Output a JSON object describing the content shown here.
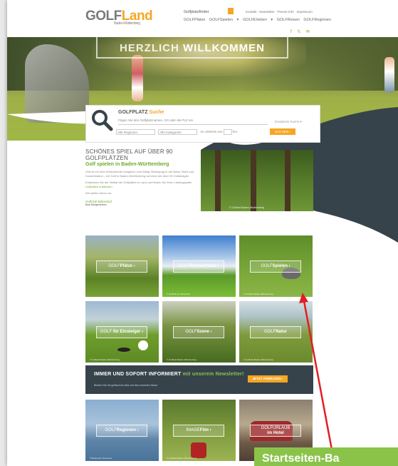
{
  "header": {
    "logo_main": "GOLF",
    "logo_accent": "Land",
    "logo_sub": "Baden-Württemberg",
    "mini_search": "Golfplatzfinder",
    "topnav": "Kontakt · Newsletter · Presse-Info · Impressum",
    "mainnav": [
      "GOLFPlätze",
      "GOLFSpielen ▾",
      "GOLFErleben ▾",
      "GOLFReisen",
      "GOLFRegionen"
    ],
    "social": "f 𝕏 ✉"
  },
  "hero": {
    "sign_light": "HERZLICH",
    "sign_bold": "WILLKOMMEN"
  },
  "search": {
    "title_prefix": "GOLFPLATZ",
    "title_suffix": "Suche",
    "placeholder": "Fügen Sie den Golfplatznamen, Ort oder die PLZ ein",
    "more": "Erweiterte Suche ▾",
    "select1": "Alle Regionen",
    "select2": "Alle Kategorien",
    "within": "im Umkreis von",
    "km": "km",
    "button": "SUCHEN ›"
  },
  "intro": {
    "headline": "SCHÖNES SPIEL AUF ÜBER 90 GOLFPLÄTZEN",
    "subheadline": "Golf spielen in Baden-Württemberg",
    "para1": "Golf ist ein sehr erfrischender Ausgleich zum Alltag. Bewegung in der Natur, Ruhe und Konzentration – bei Golf in Baden-Württemberg auf einer der über 90 Golfanlagen.",
    "para2": "Entdecken Sie die Vielfalt der Golfplätze im Land und finden Sie Ihren Lieblingsplatz.",
    "link": "Golfplätze entdecken",
    "random_label": "Wir stellen Ihnen vor:",
    "random_title": "Golfclub Birkenhof",
    "random_sub": "Bad Mergentheim",
    "image_caption": "© Golfland Baden-Württemberg"
  },
  "tiles": {
    "plaetze": {
      "prefix": "GOLF",
      "bold": "Plätze ›",
      "caption": ""
    },
    "partner": {
      "prefix": "GOLF",
      "bold": "PartnerClubs ›",
      "caption": "© Golfclub am Rheinufer"
    },
    "spielen": {
      "prefix": "GOLF",
      "bold": "Spielen ›",
      "caption": "© Golfland Baden-Württemberg"
    },
    "einsteiger": {
      "prefix": "GOLF",
      "bold": "für Einsteiger ›",
      "caption": "© Golfland Baden-Württemberg"
    },
    "szene": {
      "prefix": "GOLF",
      "bold": "Szene ›",
      "caption": "© Golfland Baden-Württemberg"
    },
    "natur": {
      "prefix": "GOLF",
      "bold": "Natur",
      "caption": "© Golfland Baden-Württemberg"
    },
    "regionen": {
      "prefix": "GOLF",
      "bold": "Regionen ›",
      "caption": "© Bodensee Tourismus"
    },
    "film": {
      "prefix": "IMAGE",
      "bold": "Film ›",
      "caption": "© Golfland Baden-Württemberg"
    },
    "hotel": {
      "prefix": "GOLFURLAUB",
      "bold": "im Hotel",
      "caption": ""
    }
  },
  "newsletter": {
    "title_white": "IMMER UND SOFORT INFORMIERT",
    "title_green": "mit unserem Newsletter!",
    "sub": "Bleiben Sie mit golfland.de stets auf dem neuesten Stand",
    "button": "JETZT ANMELDEN ›"
  },
  "annotation": {
    "label": "Startseiten-Ba"
  },
  "colors": {
    "accent_orange": "#f5a623",
    "accent_green": "#6cab2c",
    "dark_slate": "#36434a",
    "callout_green": "#8bc34a",
    "arrow_red": "#e31e24"
  }
}
